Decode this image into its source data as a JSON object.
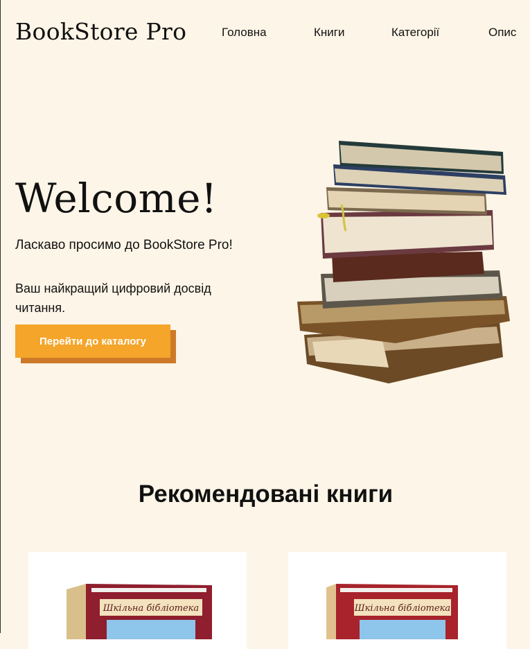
{
  "header": {
    "logo": "BookStore Pro",
    "nav": [
      "Головна",
      "Книги",
      "Категорії",
      "Опис"
    ]
  },
  "hero": {
    "title": "Welcome!",
    "line1": "Ласкаво просимо до BookStore Pro!",
    "line2": "Ваш найкращий цифровий досвід читання.",
    "cta_label": "Перейти до каталогу"
  },
  "featured": {
    "title": "Рекомендовані книги",
    "cards": [
      {
        "series": "Шкільна бібліотека"
      },
      {
        "series": "Шкільна бібліотека"
      }
    ]
  },
  "colors": {
    "background": "#fdf5e7",
    "accent": "#f4a52a",
    "accent_shadow": "#cd7a28"
  }
}
